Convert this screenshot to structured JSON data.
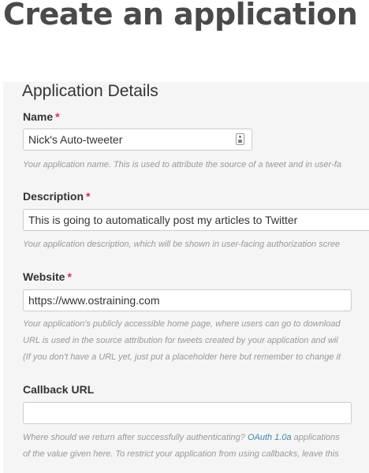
{
  "page": {
    "title": "Create an application"
  },
  "section": {
    "heading": "Application Details"
  },
  "fields": {
    "name": {
      "label": "Name",
      "required_mark": "*",
      "value": "Nick's Auto-tweeter",
      "help": "Your application name. This is used to attribute the source of a tweet and in user-fa"
    },
    "description": {
      "label": "Description",
      "required_mark": "*",
      "value": "This is going to automatically post my articles to Twitter",
      "help": "Your application description, which will be shown in user-facing authorization scree"
    },
    "website": {
      "label": "Website",
      "required_mark": "*",
      "value": "https://www.ostraining.com",
      "help_lines": [
        "Your application's publicly accessible home page, where users can go to download",
        "URL is used in the source attribution for tweets created by your application and wil",
        "(If you don't have a URL yet, just put a placeholder here but remember to change it"
      ]
    },
    "callback": {
      "label": "Callback URL",
      "value": "",
      "help_line1_before_link": "Where should we return after successfully authenticating? ",
      "help_link": "OAuth 1.0a",
      "help_line1_after_link": " applications",
      "help_line2": "of the value given here. To restrict your application from using callbacks, leave this"
    }
  },
  "icons": {
    "contact_card": "contact-card-icon"
  },
  "colors": {
    "required": "#e0245e",
    "link": "#3a87ad",
    "panel_bg": "#f5f5f5"
  }
}
